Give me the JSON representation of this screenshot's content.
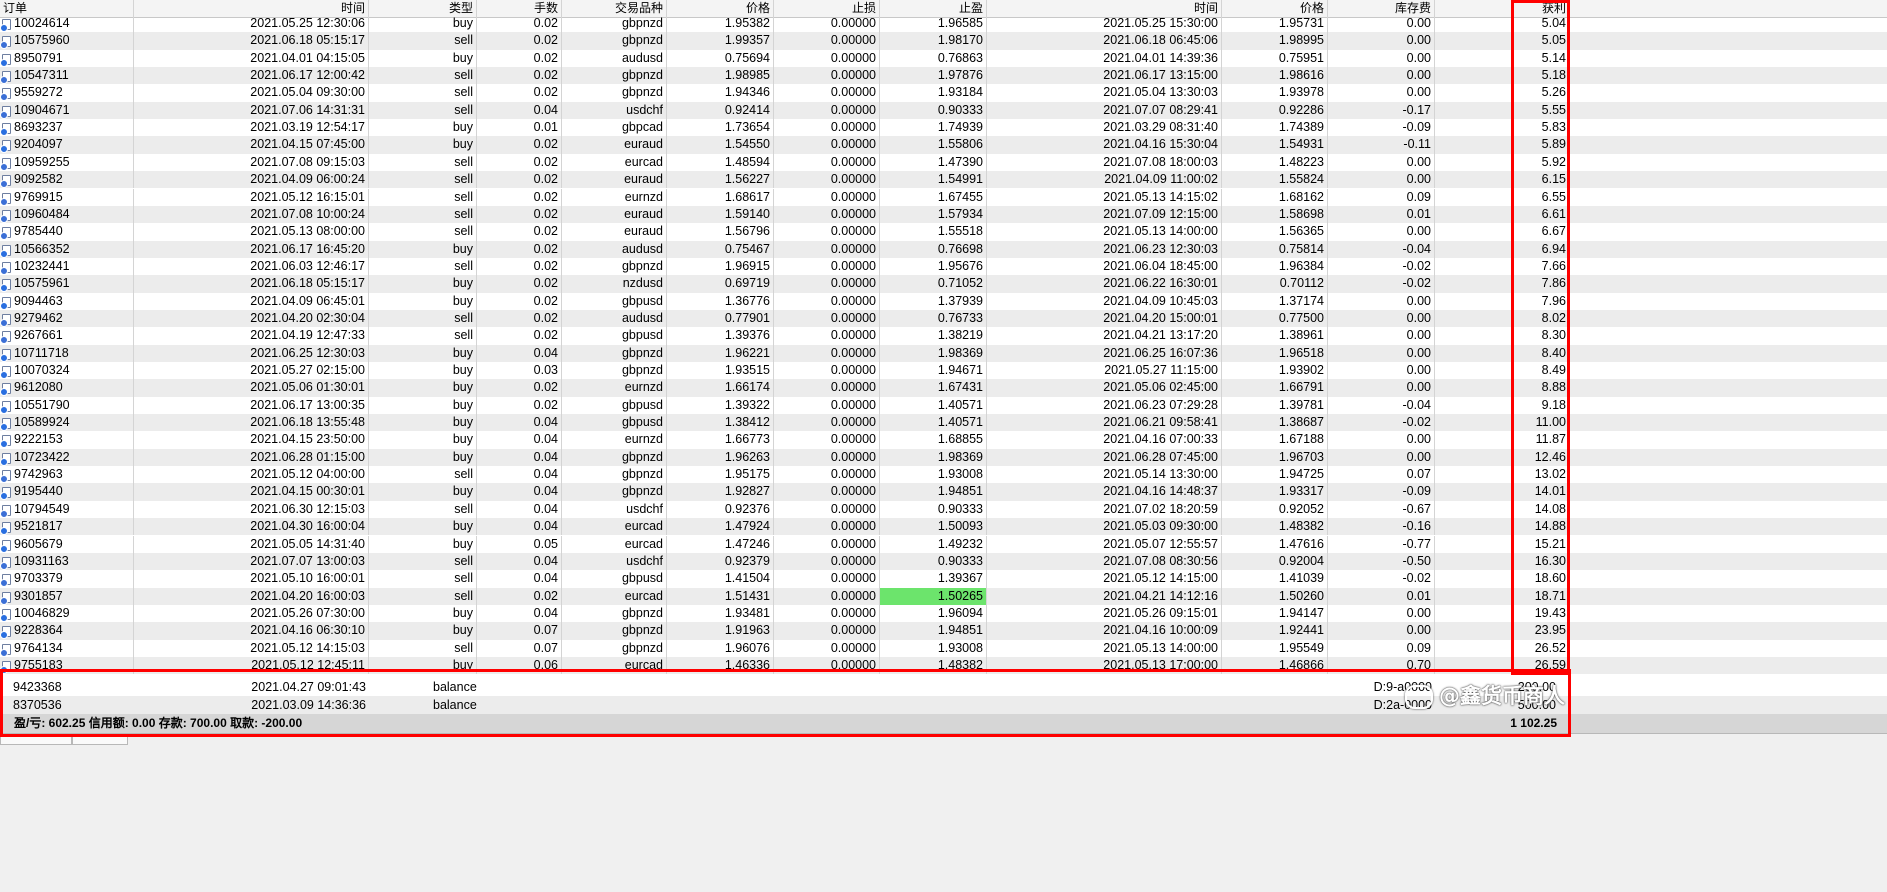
{
  "columns": [
    "订单",
    "时间",
    "类型",
    "手数",
    "交易品种",
    "价格",
    "止损",
    "止盈",
    "时间",
    "价格",
    "库存费",
    "获利"
  ],
  "sort_indicator": "/",
  "trades": [
    [
      "10024614",
      "2021.05.25 12:30:06",
      "buy",
      "0.02",
      "gbpnzd",
      "1.95382",
      "0.00000",
      "1.96585",
      "2021.05.25 15:30:00",
      "1.95731",
      "0.00",
      "5.04"
    ],
    [
      "10575960",
      "2021.06.18 05:15:17",
      "sell",
      "0.02",
      "gbpnzd",
      "1.99357",
      "0.00000",
      "1.98170",
      "2021.06.18 06:45:06",
      "1.98995",
      "0.00",
      "5.05"
    ],
    [
      "8950791",
      "2021.04.01 04:15:05",
      "buy",
      "0.02",
      "audusd",
      "0.75694",
      "0.00000",
      "0.76863",
      "2021.04.01 14:39:36",
      "0.75951",
      "0.00",
      "5.14"
    ],
    [
      "10547311",
      "2021.06.17 12:00:42",
      "sell",
      "0.02",
      "gbpnzd",
      "1.98985",
      "0.00000",
      "1.97876",
      "2021.06.17 13:15:00",
      "1.98616",
      "0.00",
      "5.18"
    ],
    [
      "9559272",
      "2021.05.04 09:30:00",
      "sell",
      "0.02",
      "gbpnzd",
      "1.94346",
      "0.00000",
      "1.93184",
      "2021.05.04 13:30:03",
      "1.93978",
      "0.00",
      "5.26"
    ],
    [
      "10904671",
      "2021.07.06 14:31:31",
      "sell",
      "0.04",
      "usdchf",
      "0.92414",
      "0.00000",
      "0.90333",
      "2021.07.07 08:29:41",
      "0.92286",
      "-0.17",
      "5.55"
    ],
    [
      "8693237",
      "2021.03.19 12:54:17",
      "buy",
      "0.01",
      "gbpcad",
      "1.73654",
      "0.00000",
      "1.74939",
      "2021.03.29 08:31:40",
      "1.74389",
      "-0.09",
      "5.83"
    ],
    [
      "9204097",
      "2021.04.15 07:45:00",
      "buy",
      "0.02",
      "euraud",
      "1.54550",
      "0.00000",
      "1.55806",
      "2021.04.16 15:30:04",
      "1.54931",
      "-0.11",
      "5.89"
    ],
    [
      "10959255",
      "2021.07.08 09:15:03",
      "sell",
      "0.02",
      "eurcad",
      "1.48594",
      "0.00000",
      "1.47390",
      "2021.07.08 18:00:03",
      "1.48223",
      "0.00",
      "5.92"
    ],
    [
      "9092582",
      "2021.04.09 06:00:24",
      "sell",
      "0.02",
      "euraud",
      "1.56227",
      "0.00000",
      "1.54991",
      "2021.04.09 11:00:02",
      "1.55824",
      "0.00",
      "6.15"
    ],
    [
      "9769915",
      "2021.05.12 16:15:01",
      "sell",
      "0.02",
      "eurnzd",
      "1.68617",
      "0.00000",
      "1.67455",
      "2021.05.13 14:15:02",
      "1.68162",
      "0.09",
      "6.55"
    ],
    [
      "10960484",
      "2021.07.08 10:00:24",
      "sell",
      "0.02",
      "euraud",
      "1.59140",
      "0.00000",
      "1.57934",
      "2021.07.09 12:15:00",
      "1.58698",
      "0.01",
      "6.61"
    ],
    [
      "9785440",
      "2021.05.13 08:00:00",
      "sell",
      "0.02",
      "euraud",
      "1.56796",
      "0.00000",
      "1.55518",
      "2021.05.13 14:00:00",
      "1.56365",
      "0.00",
      "6.67"
    ],
    [
      "10566352",
      "2021.06.17 16:45:20",
      "buy",
      "0.02",
      "audusd",
      "0.75467",
      "0.00000",
      "0.76698",
      "2021.06.23 12:30:03",
      "0.75814",
      "-0.04",
      "6.94"
    ],
    [
      "10232441",
      "2021.06.03 12:46:17",
      "sell",
      "0.02",
      "gbpnzd",
      "1.96915",
      "0.00000",
      "1.95676",
      "2021.06.04 18:45:00",
      "1.96384",
      "-0.02",
      "7.66"
    ],
    [
      "10575961",
      "2021.06.18 05:15:17",
      "buy",
      "0.02",
      "nzdusd",
      "0.69719",
      "0.00000",
      "0.71052",
      "2021.06.22 16:30:01",
      "0.70112",
      "-0.02",
      "7.86"
    ],
    [
      "9094463",
      "2021.04.09 06:45:01",
      "buy",
      "0.02",
      "gbpusd",
      "1.36776",
      "0.00000",
      "1.37939",
      "2021.04.09 10:45:03",
      "1.37174",
      "0.00",
      "7.96"
    ],
    [
      "9279462",
      "2021.04.20 02:30:04",
      "sell",
      "0.02",
      "audusd",
      "0.77901",
      "0.00000",
      "0.76733",
      "2021.04.20 15:00:01",
      "0.77500",
      "0.00",
      "8.02"
    ],
    [
      "9267661",
      "2021.04.19 12:47:33",
      "sell",
      "0.02",
      "gbpusd",
      "1.39376",
      "0.00000",
      "1.38219",
      "2021.04.21 13:17:20",
      "1.38961",
      "0.00",
      "8.30"
    ],
    [
      "10711718",
      "2021.06.25 12:30:03",
      "buy",
      "0.04",
      "gbpnzd",
      "1.96221",
      "0.00000",
      "1.98369",
      "2021.06.25 16:07:36",
      "1.96518",
      "0.00",
      "8.40"
    ],
    [
      "10070324",
      "2021.05.27 02:15:00",
      "buy",
      "0.03",
      "gbpnzd",
      "1.93515",
      "0.00000",
      "1.94671",
      "2021.05.27 11:15:00",
      "1.93902",
      "0.00",
      "8.49"
    ],
    [
      "9612080",
      "2021.05.06 01:30:01",
      "buy",
      "0.02",
      "eurnzd",
      "1.66174",
      "0.00000",
      "1.67431",
      "2021.05.06 02:45:00",
      "1.66791",
      "0.00",
      "8.88"
    ],
    [
      "10551790",
      "2021.06.17 13:00:35",
      "buy",
      "0.02",
      "gbpusd",
      "1.39322",
      "0.00000",
      "1.40571",
      "2021.06.23 07:29:28",
      "1.39781",
      "-0.04",
      "9.18"
    ],
    [
      "10589924",
      "2021.06.18 13:55:48",
      "buy",
      "0.04",
      "gbpusd",
      "1.38412",
      "0.00000",
      "1.40571",
      "2021.06.21 09:58:41",
      "1.38687",
      "-0.02",
      "11.00"
    ],
    [
      "9222153",
      "2021.04.15 23:50:00",
      "buy",
      "0.04",
      "eurnzd",
      "1.66773",
      "0.00000",
      "1.68855",
      "2021.04.16 07:00:33",
      "1.67188",
      "0.00",
      "11.87"
    ],
    [
      "10723422",
      "2021.06.28 01:15:00",
      "buy",
      "0.04",
      "gbpnzd",
      "1.96263",
      "0.00000",
      "1.98369",
      "2021.06.28 07:45:00",
      "1.96703",
      "0.00",
      "12.46"
    ],
    [
      "9742963",
      "2021.05.12 04:00:00",
      "sell",
      "0.04",
      "gbpnzd",
      "1.95175",
      "0.00000",
      "1.93008",
      "2021.05.14 13:30:00",
      "1.94725",
      "0.07",
      "13.02"
    ],
    [
      "9195440",
      "2021.04.15 00:30:01",
      "buy",
      "0.04",
      "gbpnzd",
      "1.92827",
      "0.00000",
      "1.94851",
      "2021.04.16 14:48:37",
      "1.93317",
      "-0.09",
      "14.01"
    ],
    [
      "10794549",
      "2021.06.30 12:15:03",
      "sell",
      "0.04",
      "usdchf",
      "0.92376",
      "0.00000",
      "0.90333",
      "2021.07.02 18:20:59",
      "0.92052",
      "-0.67",
      "14.08"
    ],
    [
      "9521817",
      "2021.04.30 16:00:04",
      "buy",
      "0.04",
      "eurcad",
      "1.47924",
      "0.00000",
      "1.50093",
      "2021.05.03 09:30:00",
      "1.48382",
      "-0.16",
      "14.88"
    ],
    [
      "9605679",
      "2021.05.05 14:31:40",
      "buy",
      "0.05",
      "eurcad",
      "1.47246",
      "0.00000",
      "1.49232",
      "2021.05.07 12:55:57",
      "1.47616",
      "-0.77",
      "15.21"
    ],
    [
      "10931163",
      "2021.07.07 13:00:03",
      "sell",
      "0.04",
      "usdchf",
      "0.92379",
      "0.00000",
      "0.90333",
      "2021.07.08 08:30:56",
      "0.92004",
      "-0.50",
      "16.30"
    ],
    [
      "9703379",
      "2021.05.10 16:00:01",
      "sell",
      "0.04",
      "gbpusd",
      "1.41504",
      "0.00000",
      "1.39367",
      "2021.05.12 14:15:00",
      "1.41039",
      "-0.02",
      "18.60"
    ],
    [
      "9301857",
      "2021.04.20 16:00:03",
      "sell",
      "0.02",
      "eurcad",
      "1.51431",
      "0.00000",
      "1.50265",
      "2021.04.21 14:12:16",
      "1.50260",
      "0.01",
      "18.71"
    ],
    [
      "10046829",
      "2021.05.26 07:30:00",
      "buy",
      "0.04",
      "gbpnzd",
      "1.93481",
      "0.00000",
      "1.96094",
      "2021.05.26 09:15:01",
      "1.94147",
      "0.00",
      "19.43"
    ],
    [
      "9228364",
      "2021.04.16 06:30:10",
      "buy",
      "0.07",
      "gbpnzd",
      "1.91963",
      "0.00000",
      "1.94851",
      "2021.04.16 10:00:09",
      "1.92441",
      "0.00",
      "23.95"
    ],
    [
      "9764134",
      "2021.05.12 14:15:03",
      "sell",
      "0.07",
      "gbpnzd",
      "1.96076",
      "0.00000",
      "1.93008",
      "2021.05.13 14:00:00",
      "1.95549",
      "0.09",
      "26.52"
    ],
    [
      "9755183",
      "2021.05.12 12:45:11",
      "buy",
      "0.06",
      "eurcad",
      "1.46336",
      "0.00000",
      "1.48382",
      "2021.05.13 17:00:00",
      "1.46866",
      "0.70",
      "26.59"
    ]
  ],
  "highlighted_cell": {
    "row": 33,
    "column": "止盈",
    "color": "#6ce46c"
  },
  "balance_rows": [
    {
      "ticket": "9423368",
      "time": "2021.04.27 09:01:43",
      "type": "balance",
      "comment": "D:9-a0000",
      "profit": "200.00"
    },
    {
      "ticket": "8370536",
      "time": "2021.03.09 14:36:36",
      "type": "balance",
      "comment": "D:2a-0000",
      "profit": "500.00"
    }
  ],
  "summary": {
    "text": "盈/亏: 602.25  信用额: 0.00  存款: 700.00  取款: -200.00",
    "total": "1 102.25"
  },
  "watermark": "@鑫货币商人",
  "colors": {
    "highlight": "#ff0000",
    "row_alt": "#ececec",
    "summary_bg": "#d6d6d6"
  }
}
